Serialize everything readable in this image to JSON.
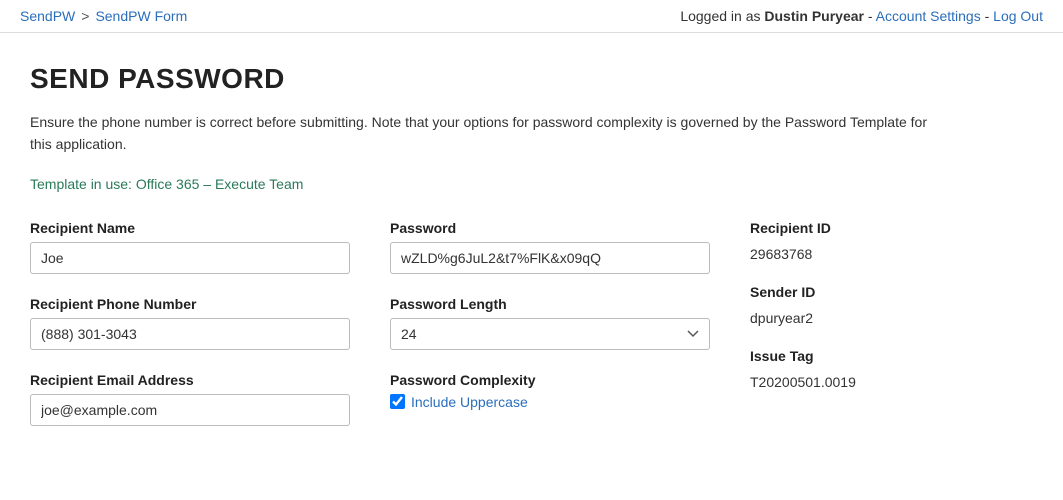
{
  "topbar": {
    "breadcrumb": {
      "link1_label": "SendPW",
      "link1_href": "#",
      "separator": ">",
      "link2_label": "SendPW Form",
      "link2_href": "#"
    },
    "auth": {
      "prefix": "Logged in as ",
      "username": "Dustin Puryear",
      "separator1": "-",
      "account_settings_label": "Account Settings",
      "separator2": "-",
      "logout_label": "Log Out"
    }
  },
  "page": {
    "title": "SEND PASSWORD",
    "description": "Ensure the phone number is correct before submitting. Note that your options for password complexity is governed by the Password Template for this application.",
    "template_info": "Template in use: Office 365 – Execute Team"
  },
  "form": {
    "recipient_name_label": "Recipient Name",
    "recipient_name_value": "Joe",
    "recipient_name_placeholder": "Joe",
    "recipient_phone_label": "Recipient Phone Number",
    "recipient_phone_value": "(888) 301-3043",
    "recipient_phone_placeholder": "(888) 301-3043",
    "recipient_email_label": "Recipient Email Address",
    "recipient_email_value": "joe@example.com",
    "recipient_email_placeholder": "joe@example.com",
    "password_label": "Password",
    "password_value": "wZLD%g6JuL2&t7%FlK&x09qQ",
    "password_length_label": "Password Length",
    "password_length_value": "24",
    "password_complexity_label": "Password Complexity",
    "include_uppercase_label": "Include Uppercase",
    "recipient_id_label": "Recipient ID",
    "recipient_id_value": "29683768",
    "sender_id_label": "Sender ID",
    "sender_id_value": "dpuryear2",
    "issue_tag_label": "Issue Tag",
    "issue_tag_value": "T20200501.0019"
  }
}
